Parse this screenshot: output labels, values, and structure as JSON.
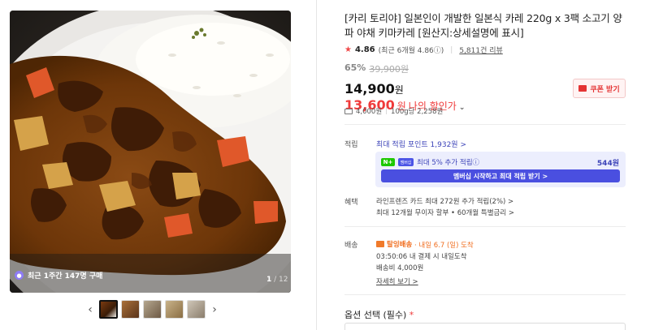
{
  "gallery": {
    "buyers_text": "최근 1주간 147명 구매",
    "counter_current": "1",
    "counter_total": "/ 12",
    "thumbnail_count": 5,
    "active_index": 0
  },
  "product": {
    "title": "[카리 토리야] 일본인이 개발한 일본식 카레 220g x 3팩 소고기 양파 야채 키마카레 [원산지:상세설명에 표시]",
    "rating": "4.86",
    "rating_detail": "(최근 6개월 4.86ⓘ)",
    "review_count": "5,811건 리뷰",
    "discount_pct": "65%",
    "original_price": "39,900원",
    "price": "14,900",
    "price_unit": "원",
    "my_price": "13,600",
    "my_price_unit": "원",
    "my_price_label": "나의 할인가",
    "coupon_button": "쿠폰 받기",
    "shipping_fee_mini": "4,000원",
    "unit_price": "100g당 2,258원"
  },
  "points": {
    "label": "적립",
    "max_link": "최대 적립 포인트 1,932원 >",
    "npay": "N+",
    "membership": "멤버십",
    "extra_text": "최대 5% 추가 적립ⓘ",
    "extra_amount": "544원",
    "cta": "멤버십 시작하고 최대 적립 받기 >"
  },
  "benefits": {
    "label": "혜택",
    "line1": "라인프렌즈 카드 최대 272원 추가 적립(2%) >",
    "line2": "최대 12개월 무이자 할부 • 60개월 특별금리 >"
  },
  "delivery": {
    "label": "배송",
    "fast": "탈잉배송",
    "arrival": "· 내일 6.7 (일) 도착",
    "cutoff": "03:50:06  내 결제 시 내일도착",
    "fee": "배송비 4,000원",
    "detail_link": "자세히 보기 >"
  },
  "options": {
    "label": "옵션 선택 (필수)",
    "required_mark": "*"
  },
  "colors": {
    "accent_red": "#f03a3a",
    "point_blue": "#4a4fe0",
    "delivery_orange": "#f06d1e"
  }
}
